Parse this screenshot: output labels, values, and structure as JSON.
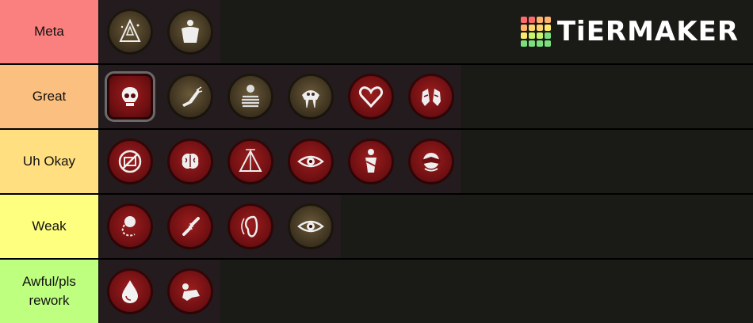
{
  "brand": {
    "name": "TiERMAKER",
    "grid_colors": [
      "#ff6b6b",
      "#ff6b6b",
      "#ffb36b",
      "#ffb36b",
      "#ffb36b",
      "#ffd76b",
      "#ffd76b",
      "#ffe96b",
      "#ffe96b",
      "#c8f56b",
      "#c8f56b",
      "#7be07b",
      "#7be07b",
      "#7be07b",
      "#7be07b",
      "#7be07b"
    ]
  },
  "tiers": [
    {
      "label": "Meta",
      "color": "#fa7f7f",
      "items": [
        {
          "icon": "triangle-sparkle-icon",
          "style": "gold"
        },
        {
          "icon": "muscular-torso-icon",
          "style": "gold"
        }
      ]
    },
    {
      "label": "Great",
      "color": "#fbbf7f",
      "items": [
        {
          "icon": "skull-icon",
          "style": "red",
          "framed": true
        },
        {
          "icon": "winged-foot-icon",
          "style": "gold"
        },
        {
          "icon": "striped-figure-icon",
          "style": "gold"
        },
        {
          "icon": "sabertooth-skull-icon",
          "style": "gold"
        },
        {
          "icon": "heart-icon",
          "style": "red"
        },
        {
          "icon": "hands-bandaged-icon",
          "style": "red"
        }
      ]
    },
    {
      "label": "Uh Okay",
      "color": "#ffdf7f",
      "items": [
        {
          "icon": "no-medkit-icon",
          "style": "red"
        },
        {
          "icon": "brain-icon",
          "style": "red"
        },
        {
          "icon": "tent-icon",
          "style": "red"
        },
        {
          "icon": "eye-icon",
          "style": "red"
        },
        {
          "icon": "injured-figure-icon",
          "style": "red"
        },
        {
          "icon": "covered-face-icon",
          "style": "red"
        }
      ]
    },
    {
      "label": "Weak",
      "color": "#ffff7f",
      "items": [
        {
          "icon": "ball-and-chain-icon",
          "style": "red"
        },
        {
          "icon": "broken-bone-icon",
          "style": "red"
        },
        {
          "icon": "ear-icon",
          "style": "red"
        },
        {
          "icon": "eye-icon",
          "style": "gold"
        }
      ]
    },
    {
      "label": "Awful/pls rework",
      "color": "#bfff7f",
      "items": [
        {
          "icon": "blood-drop-icon",
          "style": "red"
        },
        {
          "icon": "crawling-figure-icon",
          "style": "red"
        }
      ]
    }
  ]
}
